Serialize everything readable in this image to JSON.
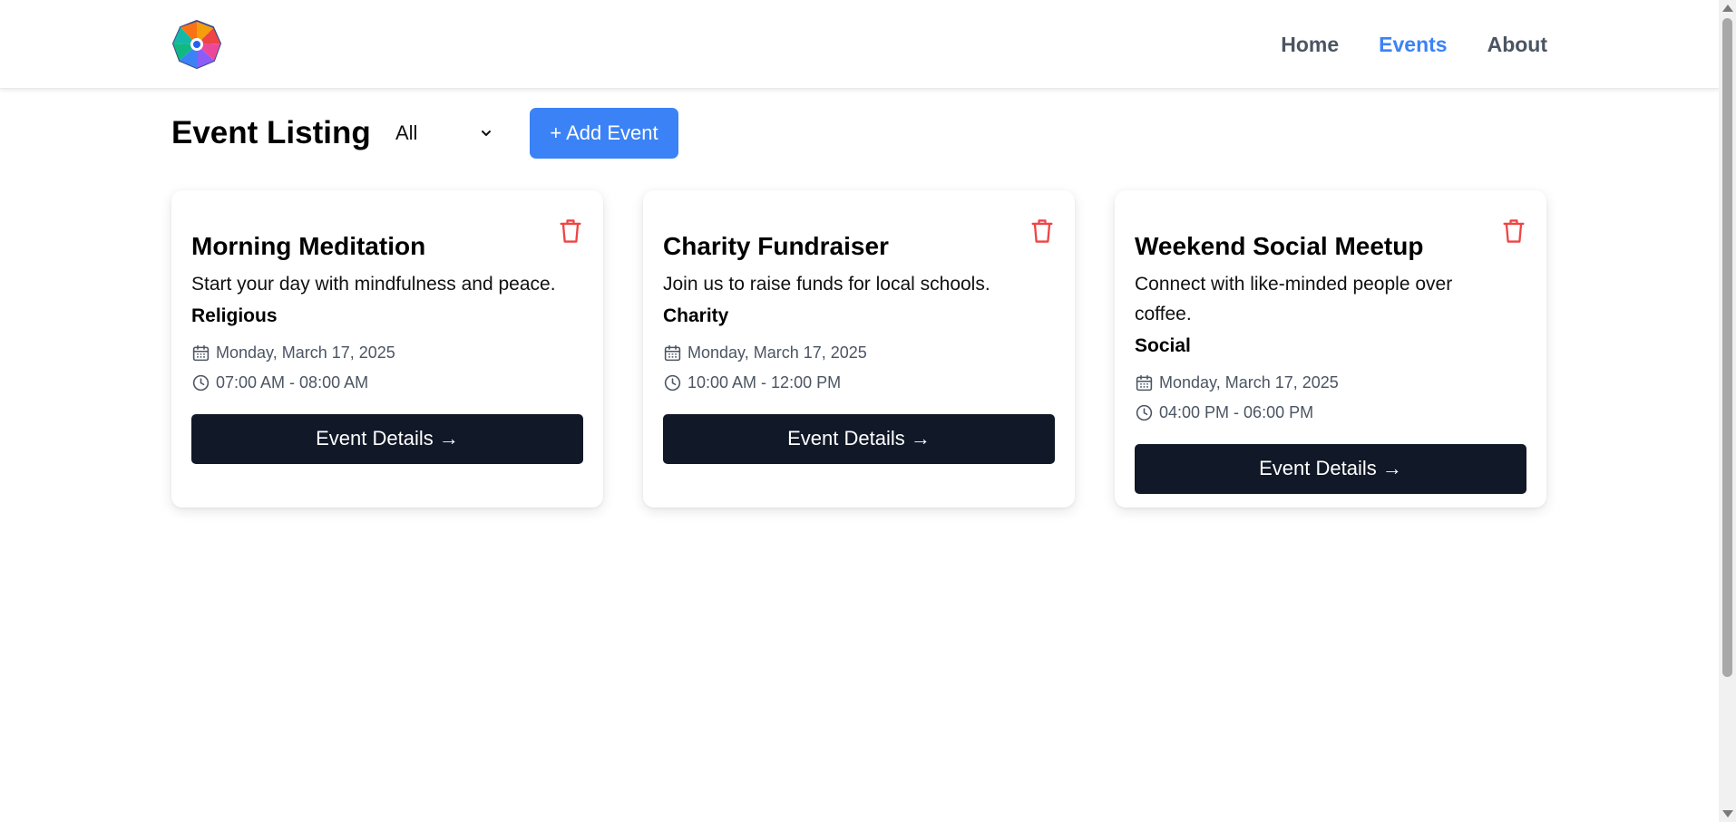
{
  "nav": {
    "logo_icon": "colorful-wheel-logo-icon",
    "links": [
      {
        "label": "Home",
        "active": false
      },
      {
        "label": "Events",
        "active": true
      },
      {
        "label": "About",
        "active": false
      }
    ],
    "active_color": "#3b82f6"
  },
  "header": {
    "title": "Event Listing",
    "filter": {
      "selected": "All",
      "icon": "chevron-down-icon"
    },
    "add_button": "+ Add Event"
  },
  "events": [
    {
      "title": "Morning Meditation",
      "description": "Start your day with mindfulness and peace.",
      "category": "Religious",
      "date": "Monday, March 17, 2025",
      "time": "07:00 AM - 08:00 AM",
      "button": "Event Details →"
    },
    {
      "title": "Charity Fundraiser",
      "description": "Join us to raise funds for local schools.",
      "category": "Charity",
      "date": "Monday, March 17, 2025",
      "time": "10:00 AM - 12:00 PM",
      "button": "Event Details →"
    },
    {
      "title": "Weekend Social Meetup",
      "description": "Connect with like-minded people over coffee.",
      "category": "Social",
      "date": "Monday, March 17, 2025",
      "time": "04:00 PM - 06:00 PM",
      "button": "Event Details →"
    }
  ],
  "colors": {
    "primary": "#3b82f6",
    "dark_button": "#111827",
    "delete": "#ef4444",
    "meta_text": "#4b5563"
  }
}
